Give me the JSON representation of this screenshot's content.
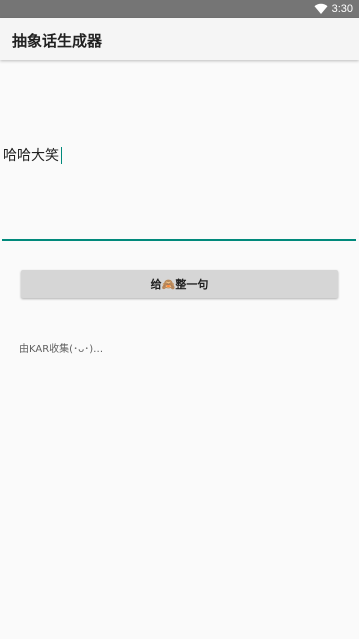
{
  "status_bar": {
    "time": "3:30",
    "wifi_icon": "wifi-icon"
  },
  "app_bar": {
    "title": "抽象话生成器"
  },
  "input": {
    "value": "哈哈大笑"
  },
  "generate_button": {
    "label": "给🙈整一句"
  },
  "credit": {
    "text": "由KAR收集(･ᴗ･)…"
  },
  "colors": {
    "accent": "#00897b",
    "status_bar": "#757575",
    "app_bar": "#f5f5f5",
    "button": "#d6d6d6"
  }
}
